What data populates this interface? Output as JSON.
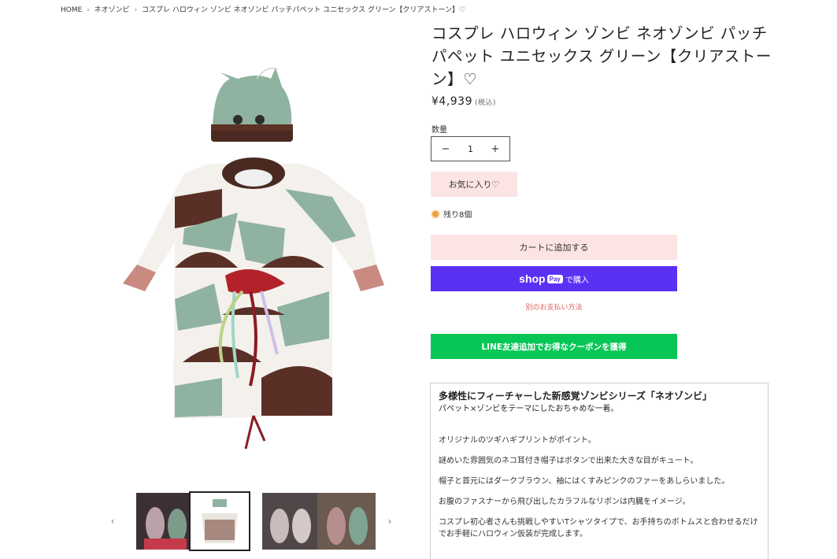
{
  "breadcrumb": {
    "home": "HOME",
    "category": "ネオゾンビ",
    "current": "コスプレ ハロウィン ゾンビ ネオゾンビ パッチパペット ユニセックス グリーン【クリアストーン】♡",
    "separator": "›"
  },
  "product": {
    "title": "コスプレ ハロウィン ゾンビ ネオゾンビ パッチパペット ユニセックス グリーン【クリアストーン】♡",
    "price": "¥4,939",
    "tax_note": "(税込)",
    "quantity_label": "数量",
    "quantity": "1",
    "minus": "−",
    "plus": "+",
    "favorite_label": "お気に入り♡",
    "stock_text": "残り8個"
  },
  "actions": {
    "add_to_cart": "カートに追加する",
    "shop_word": "shop",
    "pay_badge": "Pay",
    "buy_now": "で購入",
    "other_payment": "別のお支払い方法",
    "line_coupon": "LINE友達追加でお得なクーポンを獲得"
  },
  "description": {
    "heading": "多様性にフィーチャーした新感覚ゾンビシリーズ「ネオゾンビ」",
    "subheading": "パペット×ゾンビをテーマにしたおちゃめな一着。",
    "paragraphs": [
      "オリジナルのツギハギプリントがポイント。",
      "謎めいた雰囲気のネコ耳付き帽子はボタンで出来た大きな目がキュート。",
      "帽子と首元にはダークブラウン、袖にはくすみピンクのファーをあしらいました。",
      "お腹のファスナーから飛び出したカラフルなリボンは内臓をイメージ。",
      "コスプレ初心者さんも挑戦しやすいTシャツタイプで、お手持ちのボトムスと合わせるだけでお手軽にハロウィン仮装が完成します。"
    ]
  },
  "gallery": {
    "prev_icon": "‹",
    "next_icon": "›",
    "thumbnail_count": 4,
    "active_index": 1
  },
  "colors": {
    "shop_pay": "#5a31f4",
    "line_green": "#06c755",
    "pink_button": "#fde4e4",
    "stock_dot": "#f0a03c",
    "other_payment_link": "#e05a5a"
  }
}
